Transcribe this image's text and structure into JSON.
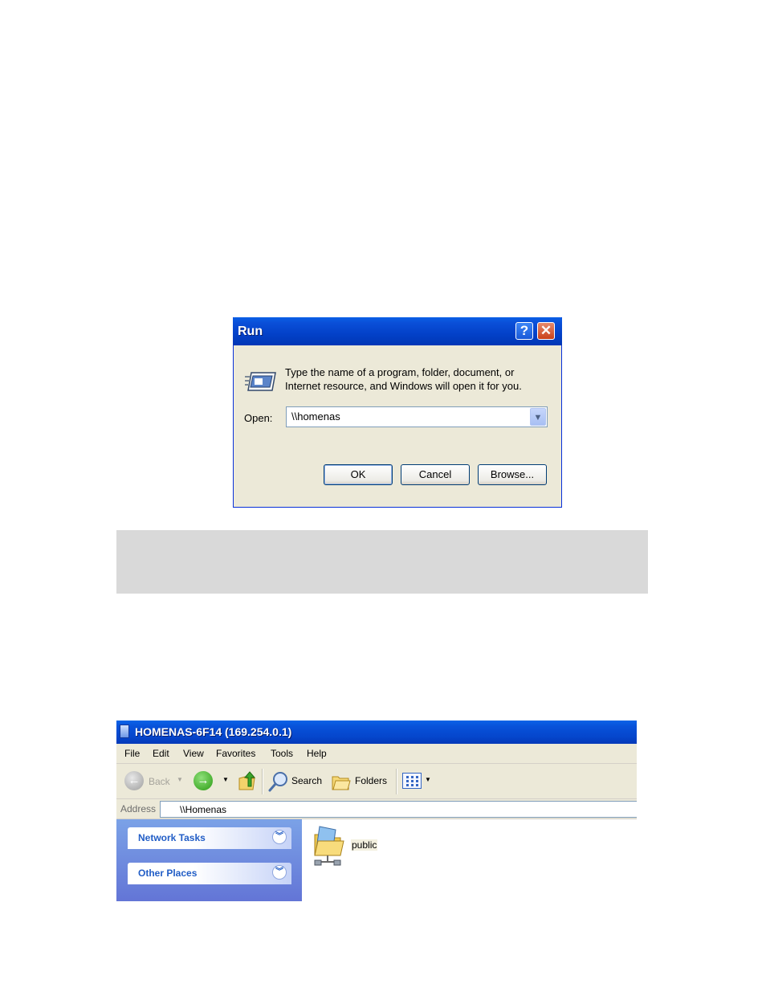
{
  "run_dialog": {
    "title": "Run",
    "help_glyph": "?",
    "close_glyph": "✕",
    "description": "Type the name of a program, folder, document, or Internet resource, and Windows will open it for you.",
    "open_label": "Open:",
    "open_value": "\\\\homenas",
    "ok_label": "OK",
    "cancel_label": "Cancel",
    "browse_label": "Browse..."
  },
  "explorer": {
    "title": "HOMENAS-6F14 (169.254.0.1)",
    "menu": [
      "File",
      "Edit",
      "View",
      "Favorites",
      "Tools",
      "Help"
    ],
    "toolbar": {
      "back_label": "Back",
      "search_label": "Search",
      "folders_label": "Folders"
    },
    "address": {
      "label": "Address",
      "value": "\\\\Homenas"
    },
    "task_pane": {
      "groups": [
        "Network Tasks",
        "Other Places"
      ]
    },
    "items": [
      {
        "label": "public",
        "icon": "shared-folder-icon"
      }
    ]
  }
}
